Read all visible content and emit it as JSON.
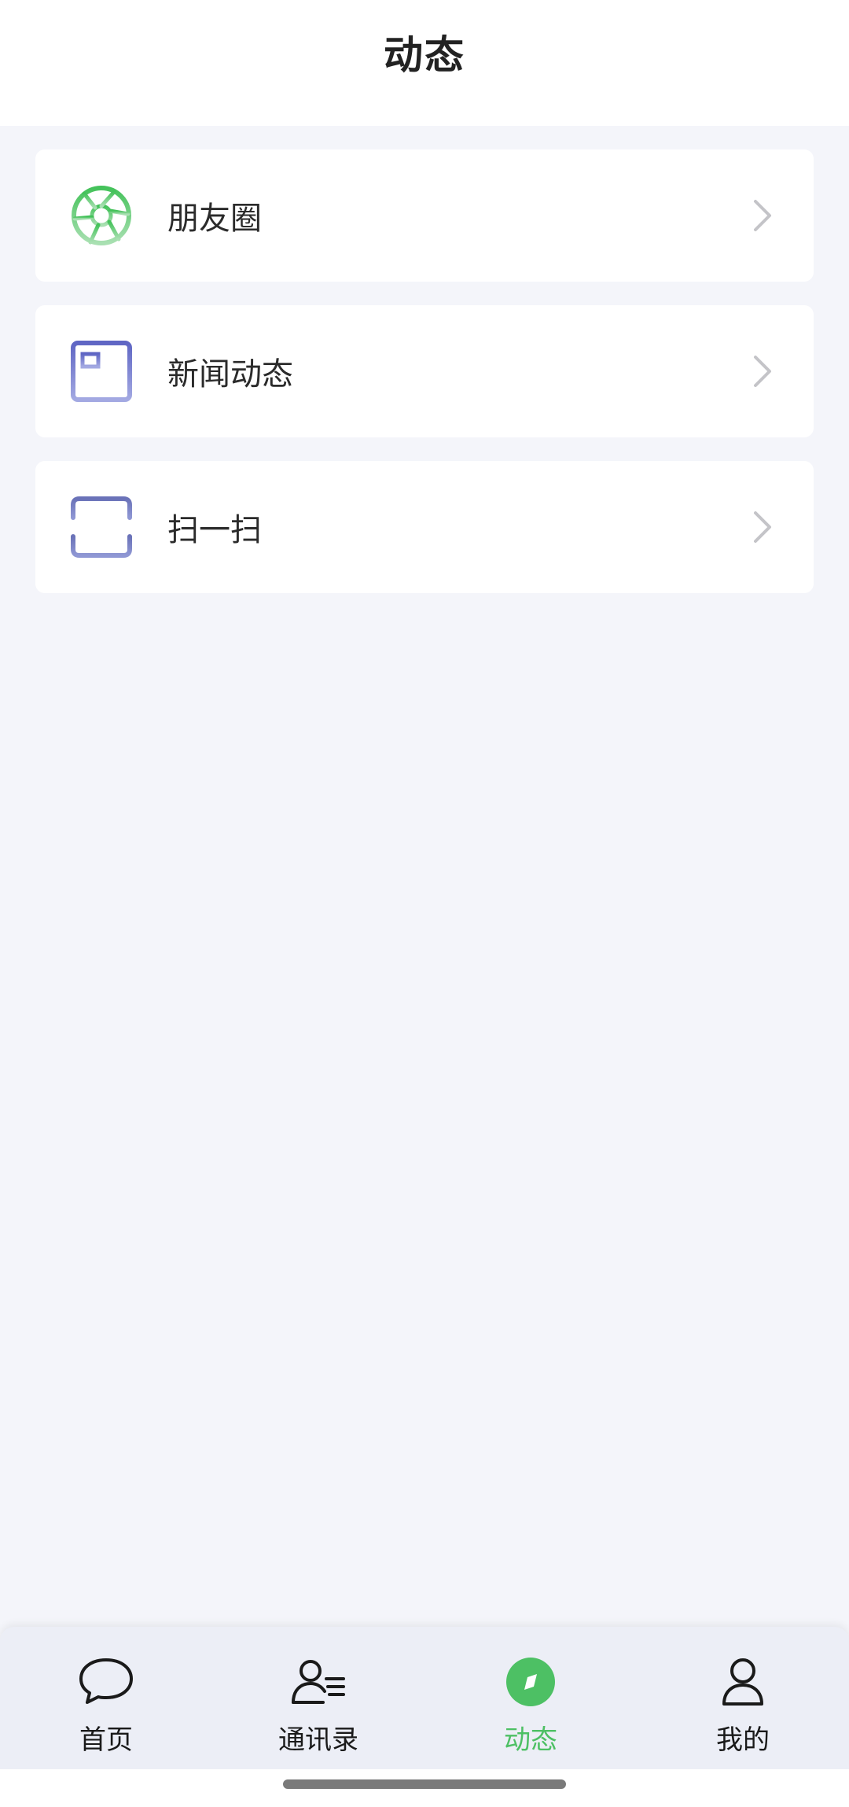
{
  "header": {
    "title": "动态"
  },
  "menu": {
    "items": [
      {
        "label": "朋友圈",
        "icon": "aperture-icon"
      },
      {
        "label": "新闻动态",
        "icon": "newspaper-icon"
      },
      {
        "label": "扫一扫",
        "icon": "scan-icon"
      }
    ]
  },
  "tabbar": {
    "items": [
      {
        "label": "首页",
        "icon": "chat-bubble-icon",
        "active": false
      },
      {
        "label": "通讯录",
        "icon": "contacts-icon",
        "active": false
      },
      {
        "label": "动态",
        "icon": "compass-icon",
        "active": true
      },
      {
        "label": "我的",
        "icon": "person-icon",
        "active": false
      }
    ]
  },
  "colors": {
    "accent": "#4dc064",
    "background": "#f4f5fa",
    "tabbar": "#eceef6",
    "icon_purple": "#6f78c8"
  }
}
